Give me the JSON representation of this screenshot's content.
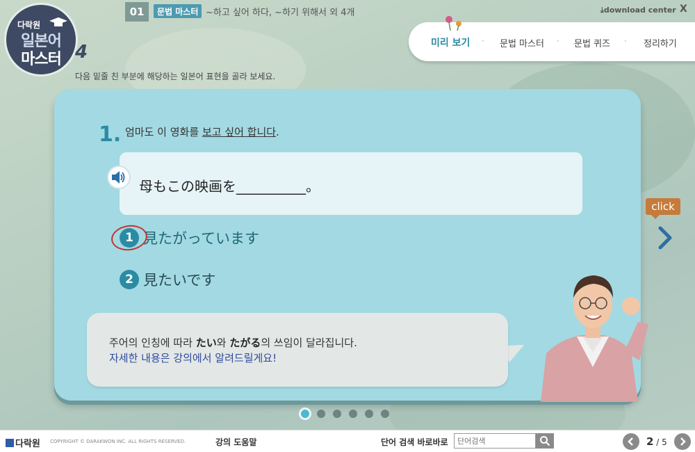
{
  "logo": {
    "line1": "다락원",
    "line2": "일본어",
    "line3": "마스터",
    "number": "4"
  },
  "lesson": {
    "number": "01",
    "tag": "문법 마스터",
    "title": "~하고 싶어 하다, ~하기 위해서 외 4개"
  },
  "header": {
    "download": "download center",
    "close": "X"
  },
  "nav": {
    "items": [
      "미리 보기",
      "문법 마스터",
      "문법 퀴즈",
      "정리하기"
    ],
    "active": "미리 보기"
  },
  "instruction": "다음 밑줄 친 부분에 해당하는 일본어 표현을 골라 보세요.",
  "question": {
    "number": "1.",
    "text_before": "엄마도 이 영화를 ",
    "text_underlined": "보고 싶어 합니다",
    "text_after": ".",
    "sentence": "母もこの映画を__________。",
    "options": [
      {
        "badge": "1",
        "text": "見たがっています"
      },
      {
        "badge": "2",
        "text": "見たいです"
      }
    ]
  },
  "bubble": {
    "line1_a": "주어의 인칭에 따라 ",
    "line1_b": "たい",
    "line1_c": "와 ",
    "line1_d": "たがる",
    "line1_e": "의 쓰임이 달라집니다.",
    "line2": "자세한 내용은 강의에서 알려드릴게요!"
  },
  "click_label": "click",
  "pagination": {
    "total_dots": 6,
    "active_dot": 1
  },
  "footer": {
    "brand": "다락원",
    "copyright": "COPYRIGHT © DARAKWON INC. ALL RIGHTS RESERVED.",
    "help": "강의 도움말",
    "search_label": "단어 검색 바로바로",
    "search_placeholder": "단어검색",
    "page_current": "2",
    "page_sep": " / ",
    "page_total": "5"
  },
  "colors": {
    "accent": "#2a8ca4",
    "card": "#a3d9e2",
    "logo": "#3e4a63",
    "click": "#c57b3b"
  }
}
